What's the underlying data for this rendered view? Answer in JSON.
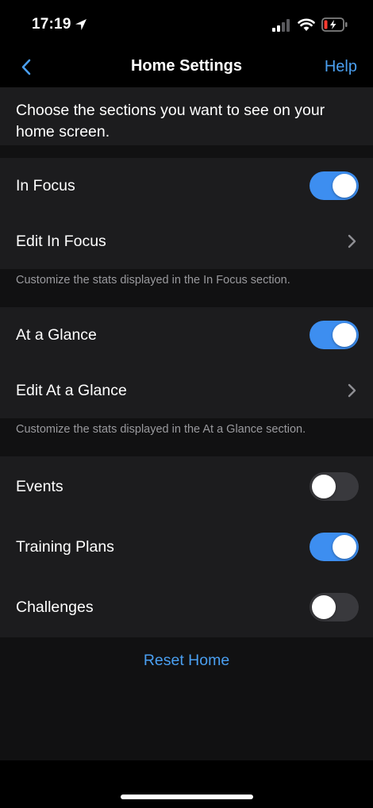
{
  "status": {
    "time": "17:19"
  },
  "nav": {
    "title": "Home Settings",
    "help": "Help"
  },
  "intro": "Choose the sections you want to see on your home screen.",
  "in_focus": {
    "toggle_label": "In Focus",
    "toggle_on": true,
    "edit_label": "Edit In Focus",
    "footnote": "Customize the stats displayed in the In Focus section."
  },
  "at_a_glance": {
    "toggle_label": "At a Glance",
    "toggle_on": true,
    "edit_label": "Edit At a Glance",
    "footnote": "Customize the stats displayed in the At a Glance section."
  },
  "other": [
    {
      "label": "Events",
      "on": false
    },
    {
      "label": "Training Plans",
      "on": true
    },
    {
      "label": "Challenges",
      "on": false
    }
  ],
  "reset_label": "Reset Home",
  "colors": {
    "accent": "#3d8ef0",
    "link": "#4a9ff0",
    "toggle_off": "#39393d",
    "cell": "#1c1c1e",
    "background": "#111112"
  }
}
